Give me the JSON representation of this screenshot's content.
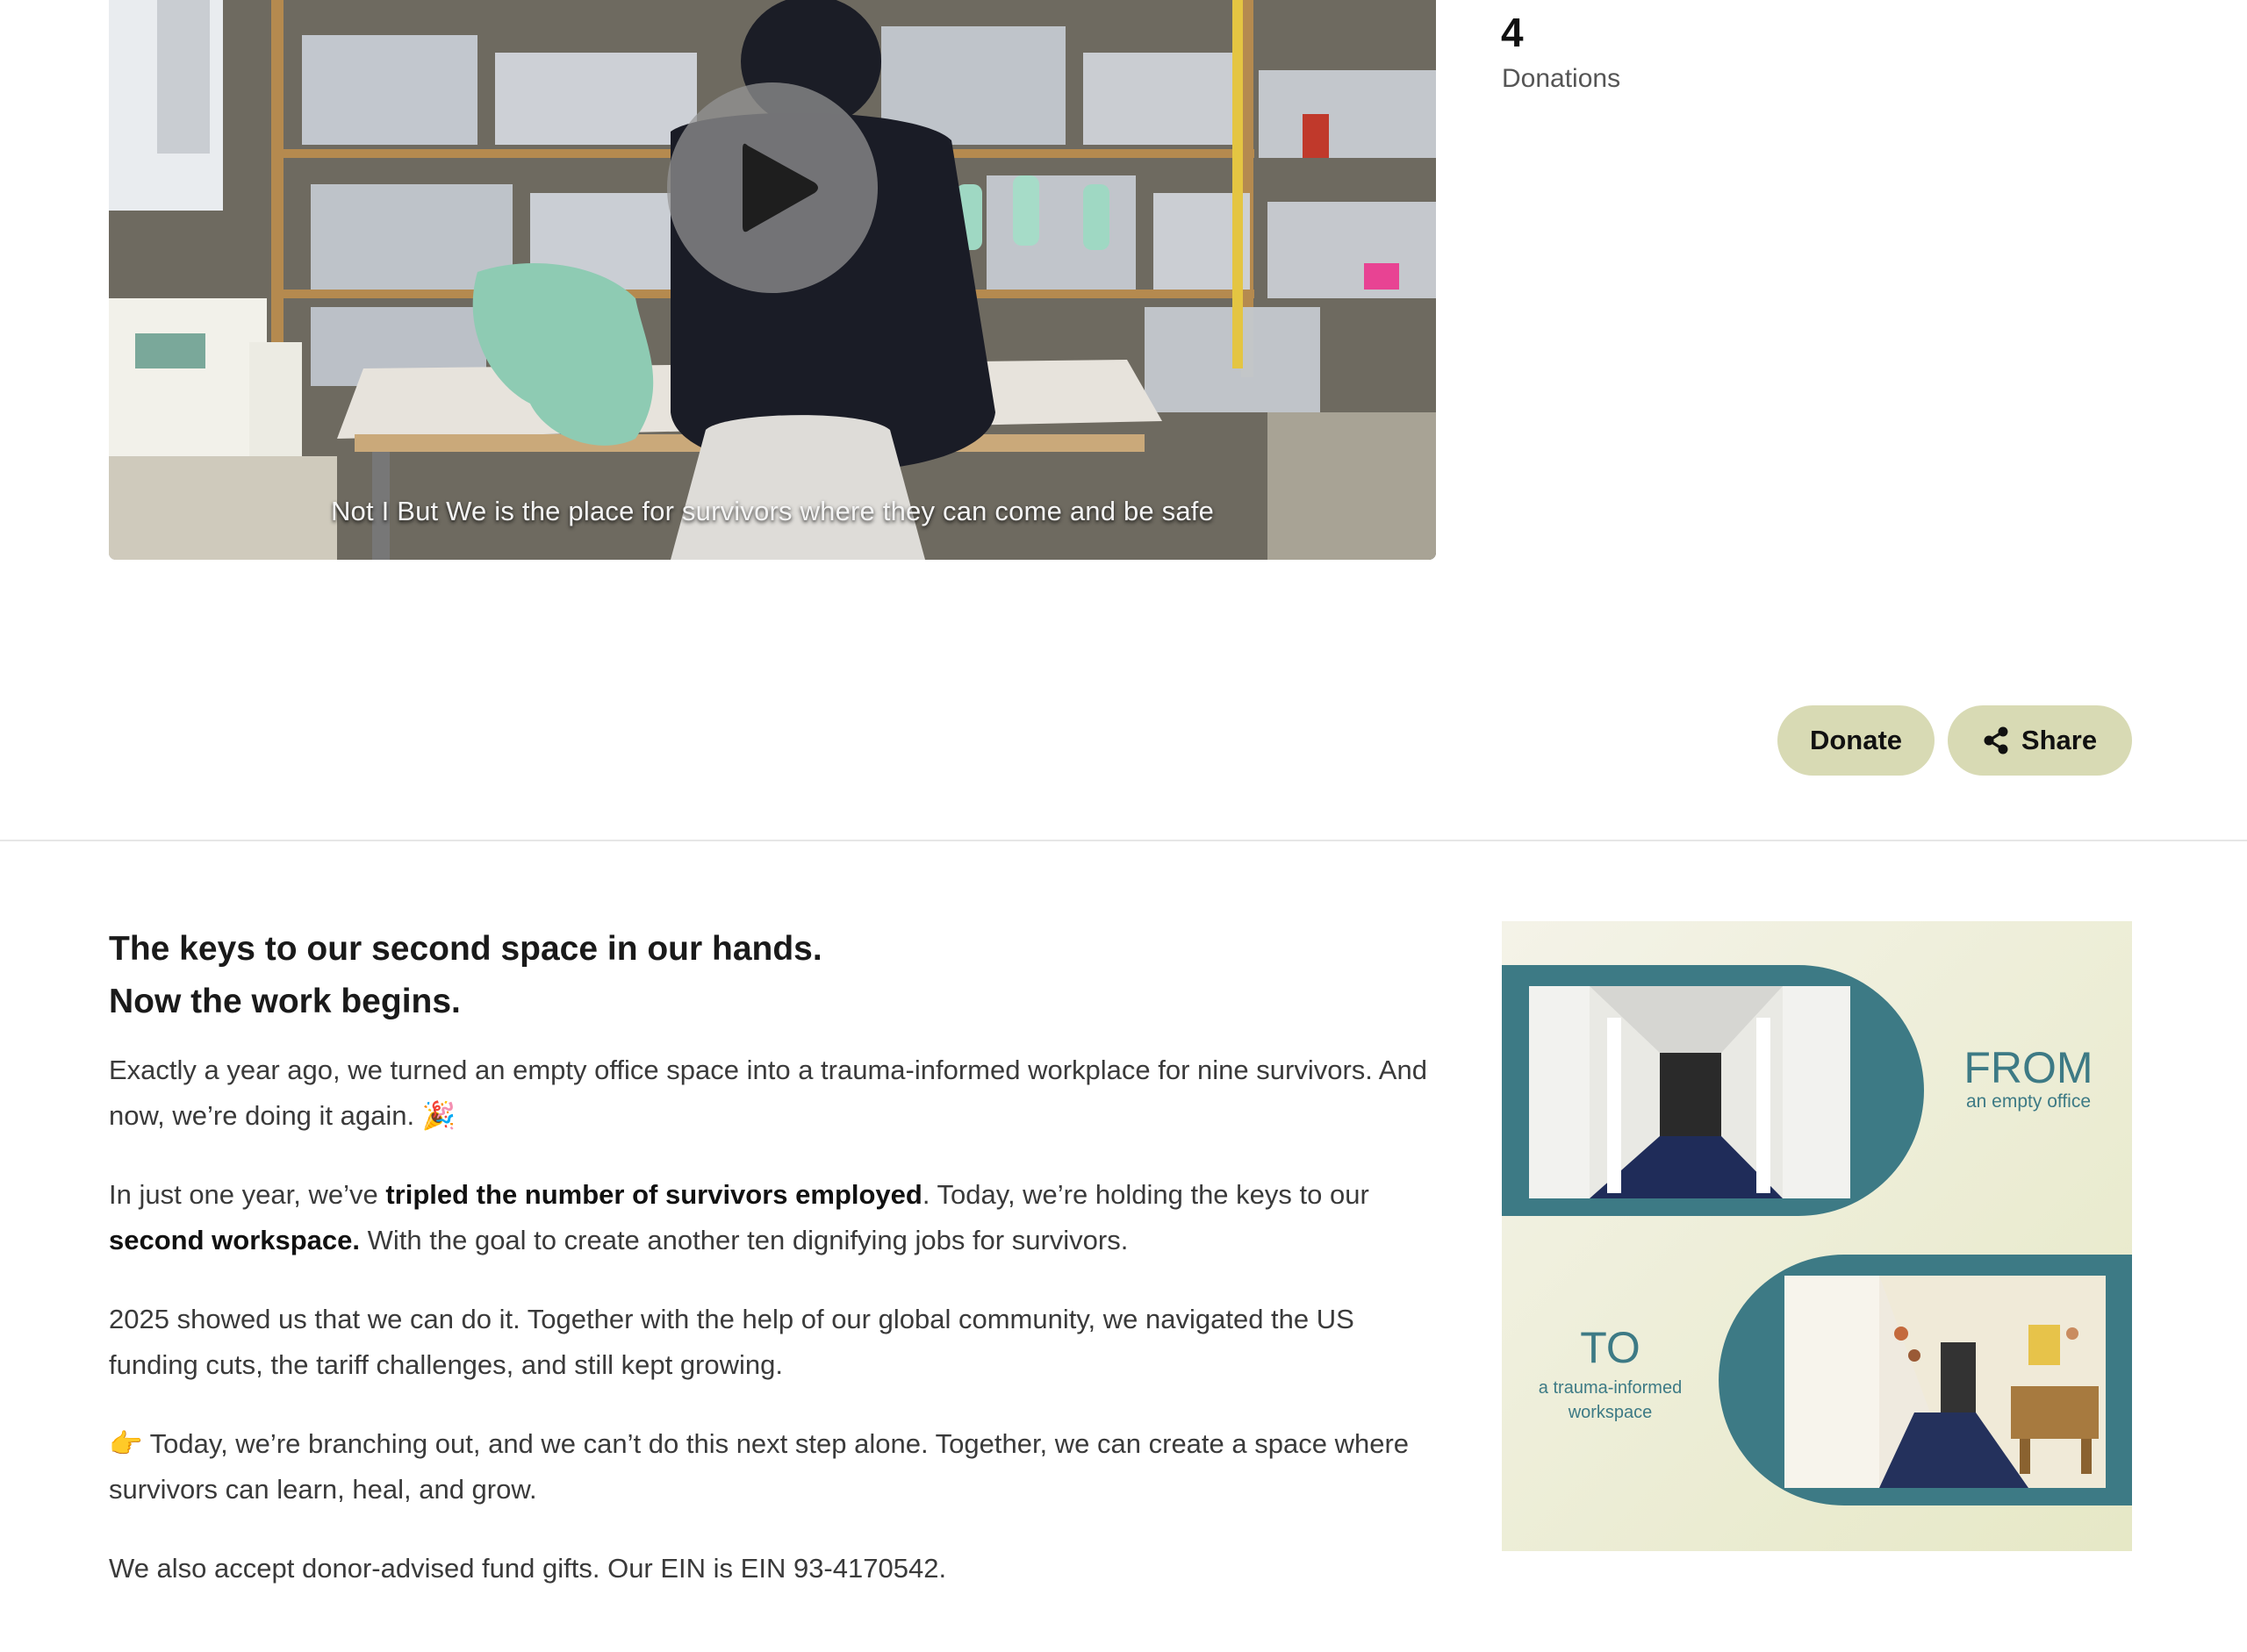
{
  "video": {
    "caption": "Not I But We is the place for survivors where they can come and be safe",
    "play_icon": "play-icon"
  },
  "stats": {
    "donations_count": "4",
    "donations_label": "Donations"
  },
  "actions": {
    "donate_label": "Donate",
    "share_label": "Share",
    "share_icon": "share-icon",
    "button_color": "#d8dab4"
  },
  "story": {
    "heading_line1": "The keys to our second space in our hands.",
    "heading_line2": "Now the work begins.",
    "p1": "Exactly a year ago, we turned an empty office space into a trauma-informed workplace for nine survivors. And now, we’re doing it again. 🎉",
    "p2_a": "In just one year, we’ve ",
    "p2_b": "tripled the number of survivors employed",
    "p2_c": ". Today, we’re holding the keys to our ",
    "p2_d": "second workspace.",
    "p2_e": " With the goal to create another ten dignifying jobs for survivors.",
    "p3": "2025 showed us that we can do it. Together with the help of our global community, we navigated the US funding cuts, the tariff challenges, and still kept growing.",
    "p4": "👉 Today, we’re branching out, and we can’t do this next step alone. Together, we can create a space where survivors can learn, heal, and grow.",
    "p5": "We also accept donor-advised fund gifts. Our EIN is EIN 93-4170542."
  },
  "promo_image": {
    "from_word": "FROM",
    "from_caption": "an empty office",
    "to_word": "TO",
    "to_caption": "a trauma-informed workspace",
    "accent_color": "#3d7a85",
    "background_color": "#eeeedd"
  }
}
